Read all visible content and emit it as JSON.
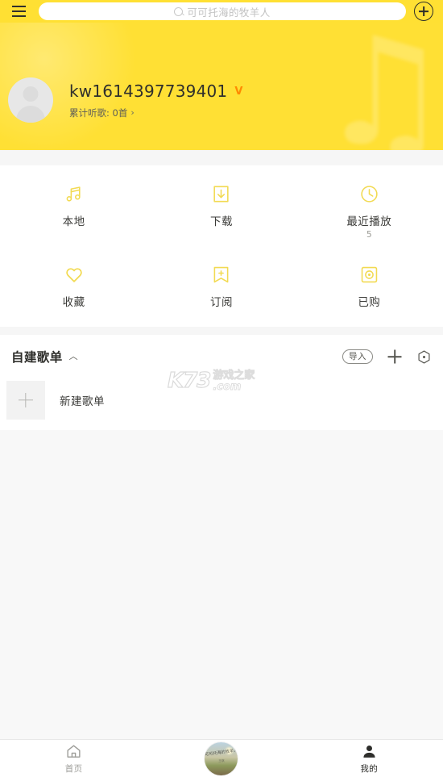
{
  "topbar": {
    "menu_icon": "hamburger-menu-icon",
    "search": {
      "icon": "search-icon",
      "placeholder": "可可托海的牧羊人",
      "value": ""
    },
    "add_icon": "plus-circle-icon"
  },
  "profile": {
    "avatar_icon": "default-user-avatar-icon",
    "username": "kw1614397739401",
    "vip_badge": "V",
    "listen_stat": "累计听歌: 0首",
    "chevron": "›"
  },
  "quick_grid": {
    "items": [
      {
        "label": "本地",
        "icon": "music-note-icon",
        "count": ""
      },
      {
        "label": "下载",
        "icon": "download-box-icon",
        "count": ""
      },
      {
        "label": "最近播放",
        "icon": "clock-icon",
        "count": "5"
      },
      {
        "label": "收藏",
        "icon": "heart-icon",
        "count": ""
      },
      {
        "label": "订阅",
        "icon": "bookmark-plus-icon",
        "count": ""
      },
      {
        "label": "已购",
        "icon": "purchased-disc-icon",
        "count": ""
      }
    ]
  },
  "playlist_section": {
    "title": "自建歌单",
    "collapse_caret": "︿",
    "import_label": "导入",
    "add_icon": "plus-icon",
    "settings_icon": "hex-gear-icon",
    "rows": [
      {
        "label": "新建歌单",
        "thumb_icon": "plus-square-icon"
      }
    ]
  },
  "watermark": {
    "brand": "K73",
    "cn": "游戏之家",
    "domain": ".com"
  },
  "bottom_nav": {
    "items": [
      {
        "label": "首页",
        "icon": "home-icon",
        "active": false
      },
      {
        "label": "",
        "icon": "now-playing-album-art",
        "active": false
      },
      {
        "label": "我的",
        "icon": "person-icon",
        "active": true
      }
    ],
    "album_art_text_top": "可可托海的牧羊人",
    "album_art_text_bottom": "王琪"
  },
  "colors": {
    "brand_yellow": "#ffe034",
    "icon_yellow": "#f4dd57",
    "vip_orange": "#ff8a00",
    "text_dark": "#2e2e2b",
    "text_muted": "#9d9d99"
  }
}
